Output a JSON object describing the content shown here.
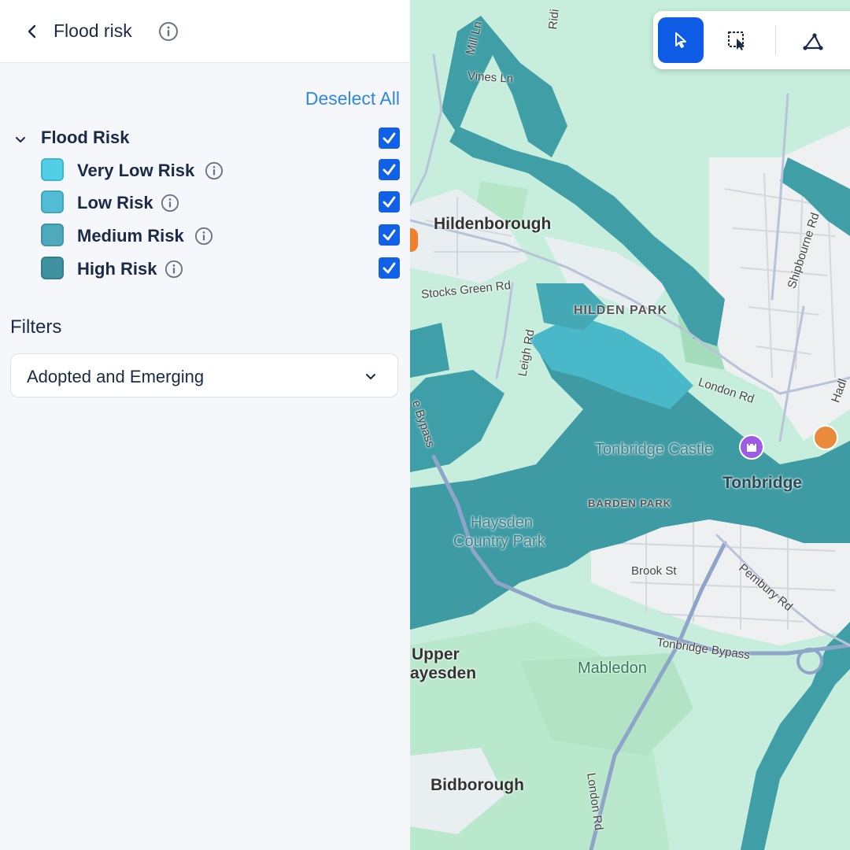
{
  "panel": {
    "title": "Flood risk",
    "deselect_all": "Deselect All",
    "group": {
      "label": "Flood Risk",
      "checked": true,
      "items": [
        {
          "label": "Very Low Risk",
          "color": "#52cfe6",
          "checked": true
        },
        {
          "label": "Low Risk",
          "color": "#52bcd4",
          "checked": true
        },
        {
          "label": "Medium Risk",
          "color": "#4fa9bd",
          "checked": true
        },
        {
          "label": "High Risk",
          "color": "#3f92a0",
          "checked": true
        }
      ]
    },
    "filters": {
      "title": "Filters",
      "selected": "Adopted and Emerging"
    }
  },
  "toolbar": {
    "tools": [
      "pointer-select-icon",
      "area-select-icon",
      "polygon-draw-icon"
    ],
    "active": "pointer-select-icon"
  },
  "map": {
    "labels": {
      "hildenborough": "Hildenborough",
      "hilden_park": "HILDEN PARK",
      "tonbridge": "Tonbridge",
      "tonbridge_castle": "Tonbridge Castle",
      "barden_park": "BARDEN PARK",
      "haysden_1": "Haysden",
      "haysden_2": "Country Park",
      "upper_1": "Upper",
      "upper_2": "ayesden",
      "mabledon": "Mabledon",
      "bidborough": "Bidborough",
      "brook_st": "Brook St",
      "stocks_green": "Stocks Green Rd",
      "leigh_rd": "Leigh Rd",
      "london_rd": "London Rd",
      "london_rd_2": "London Rd",
      "shipbourne": "Shipbourne Rd",
      "pembury": "Pembury Rd",
      "bypass": "Tonbridge Bypass",
      "bypass_west": "e Bypass",
      "vines": "Vines Ln",
      "mill": "Mill Ln",
      "ridi": "Ridi",
      "hadl": "Hadl"
    },
    "colors": {
      "land": "#c7eedd",
      "park": "#b4e6c8",
      "urban": "#eef0f2",
      "flood_high": "#3b9aa3",
      "flood_low": "#49bccd",
      "road": "#8fa4c9"
    }
  }
}
